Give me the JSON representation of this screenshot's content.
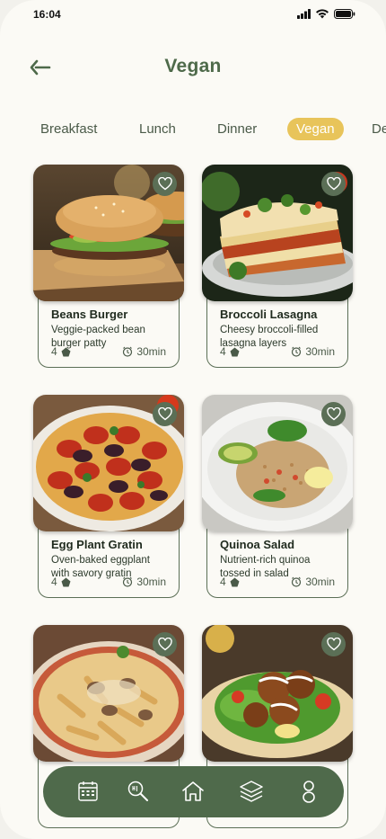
{
  "status_bar": {
    "time": "16:04",
    "icons": [
      "cellular-signal-icon",
      "wifi-icon",
      "battery-icon"
    ]
  },
  "header": {
    "title": "Vegan",
    "back_icon": "back-arrow-icon"
  },
  "tabs": [
    {
      "label": "Breakfast",
      "active": false
    },
    {
      "label": "Lunch",
      "active": false
    },
    {
      "label": "Dinner",
      "active": false
    },
    {
      "label": "Vegan",
      "active": true
    },
    {
      "label": "De",
      "active": false
    }
  ],
  "recipes": [
    {
      "name": "Beans Burger",
      "desc_line1": "Veggie-packed bean",
      "desc_line2": "burger patty",
      "rating": "4",
      "time": "30min"
    },
    {
      "name": "Broccoli Lasagna",
      "desc_line1": "Cheesy broccoli-filled",
      "desc_line2": "lasagna layers",
      "rating": "4",
      "time": "30min"
    },
    {
      "name": "Egg Plant Gratin",
      "desc_line1": "Oven-baked eggplant",
      "desc_line2": "with savory gratin",
      "rating": "4",
      "time": "30min"
    },
    {
      "name": "Quinoa Salad",
      "desc_line1": "Nutrient-rich quinoa",
      "desc_line2": "tossed in salad",
      "rating": "4",
      "time": "30min"
    },
    {
      "name": "",
      "desc_line1": "",
      "desc_line2": "",
      "rating": "",
      "time": ""
    },
    {
      "name": "",
      "desc_line1": "",
      "desc_line2": "",
      "rating": "",
      "time": ""
    }
  ],
  "nav": {
    "items": [
      "calendar-icon",
      "search-food-icon",
      "home-icon",
      "layers-icon",
      "profile-icon"
    ]
  },
  "colors": {
    "accent_green": "#4f6a4b",
    "title_green": "#4e6a4a",
    "active_tab": "#e8c45a",
    "background": "#fbfaf5"
  }
}
